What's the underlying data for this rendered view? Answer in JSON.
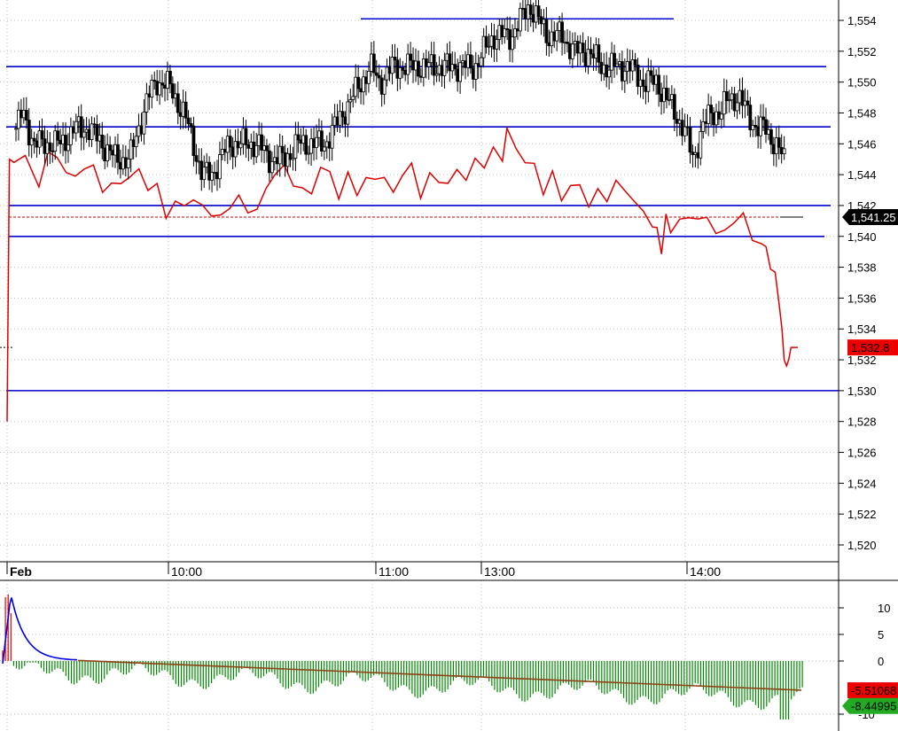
{
  "chart_data": [
    {
      "type": "candlestick",
      "panel": "price",
      "ylim": [
        1518,
        1555.5
      ],
      "yticks": [
        "1,520",
        "1,522",
        "1,524",
        "1,526",
        "1,528",
        "1,530",
        "1,532",
        "1,534",
        "1,536",
        "1,538",
        "1,540",
        "1,542",
        "1,544",
        "1,546",
        "1,548",
        "1,550",
        "1,552",
        "1,554"
      ],
      "ytick_values": [
        1520,
        1522,
        1524,
        1526,
        1528,
        1530,
        1532,
        1534,
        1536,
        1538,
        1540,
        1542,
        1544,
        1546,
        1548,
        1550,
        1552,
        1554
      ],
      "xticks": [
        "Feb",
        "10:00",
        "11:00",
        "13:00",
        "14:00"
      ],
      "grid": true,
      "horizontal_levels": [
        {
          "value": 1554.1,
          "color": "#0000cc"
        },
        {
          "value": 1551.0,
          "color": "#0000cc"
        },
        {
          "value": 1547.1,
          "color": "#0000cc"
        },
        {
          "value": 1542.0,
          "color": "#0000cc"
        },
        {
          "value": 1540.0,
          "color": "#0000cc"
        },
        {
          "value": 1530.0,
          "color": "#0000cc"
        }
      ],
      "last_price_line": {
        "value": 1541.25,
        "color": "#cc0000"
      },
      "labels": [
        {
          "text": "1,541.25",
          "value": 1541.25,
          "bg": "#000000",
          "fg": "#ffffff"
        },
        {
          "text": "1,532.8",
          "value": 1532.8,
          "bg": "#ee0000",
          "fg": "#000000"
        }
      ],
      "candles_path": [
        [
          0,
          1547
        ],
        [
          3,
          1548
        ],
        [
          8,
          1546
        ],
        [
          14,
          1546
        ],
        [
          20,
          1546
        ],
        [
          26,
          1547
        ],
        [
          32,
          1547
        ],
        [
          38,
          1546
        ],
        [
          44,
          1545
        ],
        [
          50,
          1545
        ],
        [
          54,
          1547
        ],
        [
          58,
          1549
        ],
        [
          62,
          1550
        ],
        [
          66,
          1550
        ],
        [
          70,
          1549
        ],
        [
          74,
          1548
        ],
        [
          78,
          1546
        ],
        [
          80,
          1545
        ],
        [
          82,
          1544
        ],
        [
          86,
          1544
        ],
        [
          90,
          1545
        ],
        [
          94,
          1546
        ],
        [
          100,
          1546
        ],
        [
          106,
          1546
        ],
        [
          112,
          1545
        ],
        [
          118,
          1545
        ],
        [
          124,
          1546
        ],
        [
          130,
          1546
        ],
        [
          136,
          1546
        ],
        [
          140,
          1547
        ],
        [
          144,
          1548
        ],
        [
          148,
          1549
        ],
        [
          152,
          1550
        ],
        [
          156,
          1551
        ],
        [
          160,
          1550
        ],
        [
          166,
          1551
        ],
        [
          172,
          1551
        ],
        [
          178,
          1551
        ],
        [
          184,
          1551
        ],
        [
          190,
          1551
        ],
        [
          196,
          1551
        ],
        [
          202,
          1551
        ],
        [
          206,
          1552
        ],
        [
          210,
          1553
        ],
        [
          214,
          1553
        ],
        [
          218,
          1553
        ],
        [
          222,
          1554
        ],
        [
          226,
          1555
        ],
        [
          230,
          1554
        ],
        [
          234,
          1553
        ],
        [
          240,
          1553
        ],
        [
          246,
          1552
        ],
        [
          252,
          1552
        ],
        [
          258,
          1551
        ],
        [
          264,
          1551
        ],
        [
          270,
          1551
        ],
        [
          276,
          1550
        ],
        [
          282,
          1550
        ],
        [
          286,
          1549
        ],
        [
          290,
          1548
        ],
        [
          294,
          1547
        ],
        [
          296,
          1546
        ],
        [
          298,
          1545
        ],
        [
          300,
          1546
        ],
        [
          302,
          1547
        ],
        [
          306,
          1548
        ],
        [
          310,
          1548
        ],
        [
          314,
          1549
        ],
        [
          318,
          1549
        ],
        [
          322,
          1548
        ],
        [
          326,
          1547
        ],
        [
          330,
          1547
        ],
        [
          334,
          1546
        ],
        [
          338,
          1545
        ],
        [
          340,
          1544
        ],
        [
          342,
          1543
        ],
        [
          344,
          1542
        ]
      ],
      "candles_color": "#000000",
      "indicator_line_name": "",
      "indicator_color": "#dd0000",
      "indicator_path": [
        [
          0,
          1528
        ],
        [
          1,
          1545
        ],
        [
          3,
          1545
        ],
        [
          8,
          1545
        ],
        [
          14,
          1544
        ],
        [
          18,
          1545
        ],
        [
          22,
          1545
        ],
        [
          26,
          1544
        ],
        [
          30,
          1544
        ],
        [
          34,
          1545
        ],
        [
          38,
          1544
        ],
        [
          42,
          1543
        ],
        [
          46,
          1543
        ],
        [
          50,
          1544
        ],
        [
          54,
          1544
        ],
        [
          58,
          1544
        ],
        [
          62,
          1543
        ],
        [
          66,
          1543
        ],
        [
          70,
          1542
        ],
        [
          74,
          1542
        ],
        [
          78,
          1542
        ],
        [
          82,
          1542
        ],
        [
          86,
          1542
        ],
        [
          90,
          1542
        ],
        [
          94,
          1541
        ],
        [
          98,
          1542
        ],
        [
          102,
          1542
        ],
        [
          106,
          1542
        ],
        [
          110,
          1542
        ],
        [
          114,
          1543
        ],
        [
          118,
          1544
        ],
        [
          122,
          1544
        ],
        [
          126,
          1544
        ],
        [
          130,
          1543
        ],
        [
          134,
          1543
        ],
        [
          138,
          1544
        ],
        [
          142,
          1544
        ],
        [
          146,
          1543
        ],
        [
          150,
          1544
        ],
        [
          154,
          1543
        ],
        [
          158,
          1543
        ],
        [
          162,
          1544
        ],
        [
          166,
          1544
        ],
        [
          170,
          1543
        ],
        [
          174,
          1544
        ],
        [
          178,
          1544
        ],
        [
          182,
          1543
        ],
        [
          186,
          1544
        ],
        [
          190,
          1544
        ],
        [
          194,
          1543
        ],
        [
          198,
          1544
        ],
        [
          202,
          1544
        ],
        [
          206,
          1545
        ],
        [
          210,
          1545
        ],
        [
          214,
          1545
        ],
        [
          218,
          1545
        ],
        [
          220,
          1547
        ],
        [
          224,
          1546
        ],
        [
          228,
          1545
        ],
        [
          232,
          1544
        ],
        [
          236,
          1543
        ],
        [
          240,
          1544
        ],
        [
          244,
          1543
        ],
        [
          248,
          1543
        ],
        [
          252,
          1543
        ],
        [
          256,
          1542
        ],
        [
          260,
          1543
        ],
        [
          264,
          1543
        ],
        [
          268,
          1543
        ],
        [
          272,
          1543
        ],
        [
          276,
          1542
        ],
        [
          280,
          1542
        ],
        [
          284,
          1541
        ],
        [
          286,
          1540
        ],
        [
          288,
          1539
        ],
        [
          290,
          1541
        ],
        [
          292,
          1541
        ],
        [
          296,
          1541
        ],
        [
          300,
          1541
        ],
        [
          304,
          1541
        ],
        [
          308,
          1541
        ],
        [
          312,
          1541
        ],
        [
          316,
          1540
        ],
        [
          320,
          1541
        ],
        [
          324,
          1541
        ],
        [
          328,
          1540
        ],
        [
          332,
          1540
        ],
        [
          334,
          1539
        ],
        [
          336,
          1538
        ],
        [
          338,
          1537
        ],
        [
          340,
          1536
        ],
        [
          341,
          1534
        ],
        [
          342,
          1532
        ],
        [
          343,
          1531.6
        ],
        [
          344,
          1532
        ],
        [
          345,
          1532.8
        ],
        [
          348,
          1532.8
        ]
      ]
    },
    {
      "type": "histogram",
      "panel": "oscillator",
      "ylim": [
        -11,
        14
      ],
      "yticks": [
        "10",
        "5",
        "0",
        "-10"
      ],
      "ytick_values": [
        10,
        5,
        0,
        -10
      ],
      "grid": true,
      "signal_color": "#0000dd",
      "signal_late_color": "#8b4513",
      "bar_pos_color": "#dd0000",
      "bar_neg_color": "#008800",
      "labels": [
        {
          "text": "-5.51068",
          "value": -5.51068,
          "bg": "#ee0000",
          "fg": "#000000"
        },
        {
          "text": "-8.44995",
          "value": -8.44995,
          "bg": "#22aa22",
          "fg": "#000000"
        }
      ]
    }
  ]
}
